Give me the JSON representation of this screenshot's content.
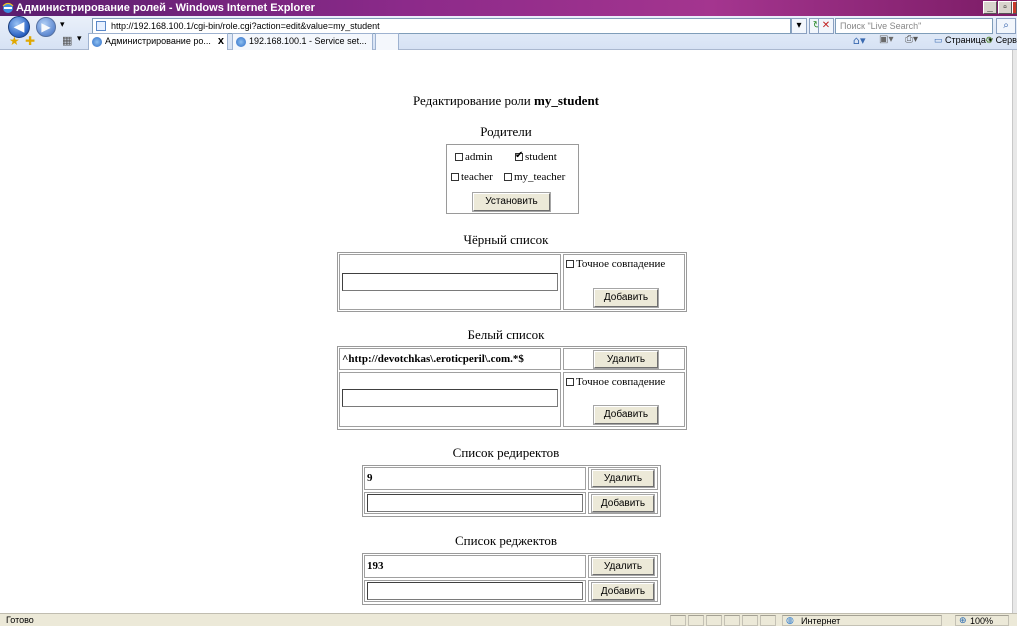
{
  "window": {
    "title": "Администрирование ролей - Windows Internet Explorer",
    "btn_min": "_",
    "btn_max": "▫",
    "btn_close": "x"
  },
  "address": {
    "url": "http://192.168.100.1/cgi-bin/role.cgi?action=edit&value=my_student",
    "search_placeholder": "Поиск \"Live Search\""
  },
  "tabs": [
    {
      "label": "Администрирование ро...",
      "close": "x"
    },
    {
      "label": "192.168.100.1 - Service set..."
    }
  ],
  "commands": {
    "page": "Страница ▾",
    "tools": "Сервис ▾"
  },
  "page": {
    "heading_prefix": "Редактирование роли",
    "role_name": "my_student",
    "parents": {
      "title": "Родители",
      "items": [
        {
          "label": "admin",
          "checked": false
        },
        {
          "label": "student",
          "checked": true
        },
        {
          "label": "teacher",
          "checked": false
        },
        {
          "label": "my_teacher",
          "checked": false
        }
      ],
      "button": "Установить"
    },
    "blacklist": {
      "title": "Чёрный список",
      "exact_label": "Точное совпадение",
      "add_button": "Добавить",
      "input_value": ""
    },
    "whitelist": {
      "title": "Белый список",
      "entry": "^http://devotchkas\\.eroticperil\\.com.*$",
      "delete_button": "Удалить",
      "exact_label": "Точное совпадение",
      "add_button": "Добавить",
      "input_value": ""
    },
    "redirects": {
      "title": "Список редиректов",
      "entry": "9",
      "delete_button": "Удалить",
      "add_button": "Добавить",
      "input_value": ""
    },
    "rejects": {
      "title": "Список реджектов",
      "entry": "193",
      "delete_button": "Удалить",
      "add_button": "Добавить",
      "input_value": ""
    }
  },
  "status": {
    "left": "Готово",
    "zone": "Интернет",
    "zoom": "100%"
  }
}
